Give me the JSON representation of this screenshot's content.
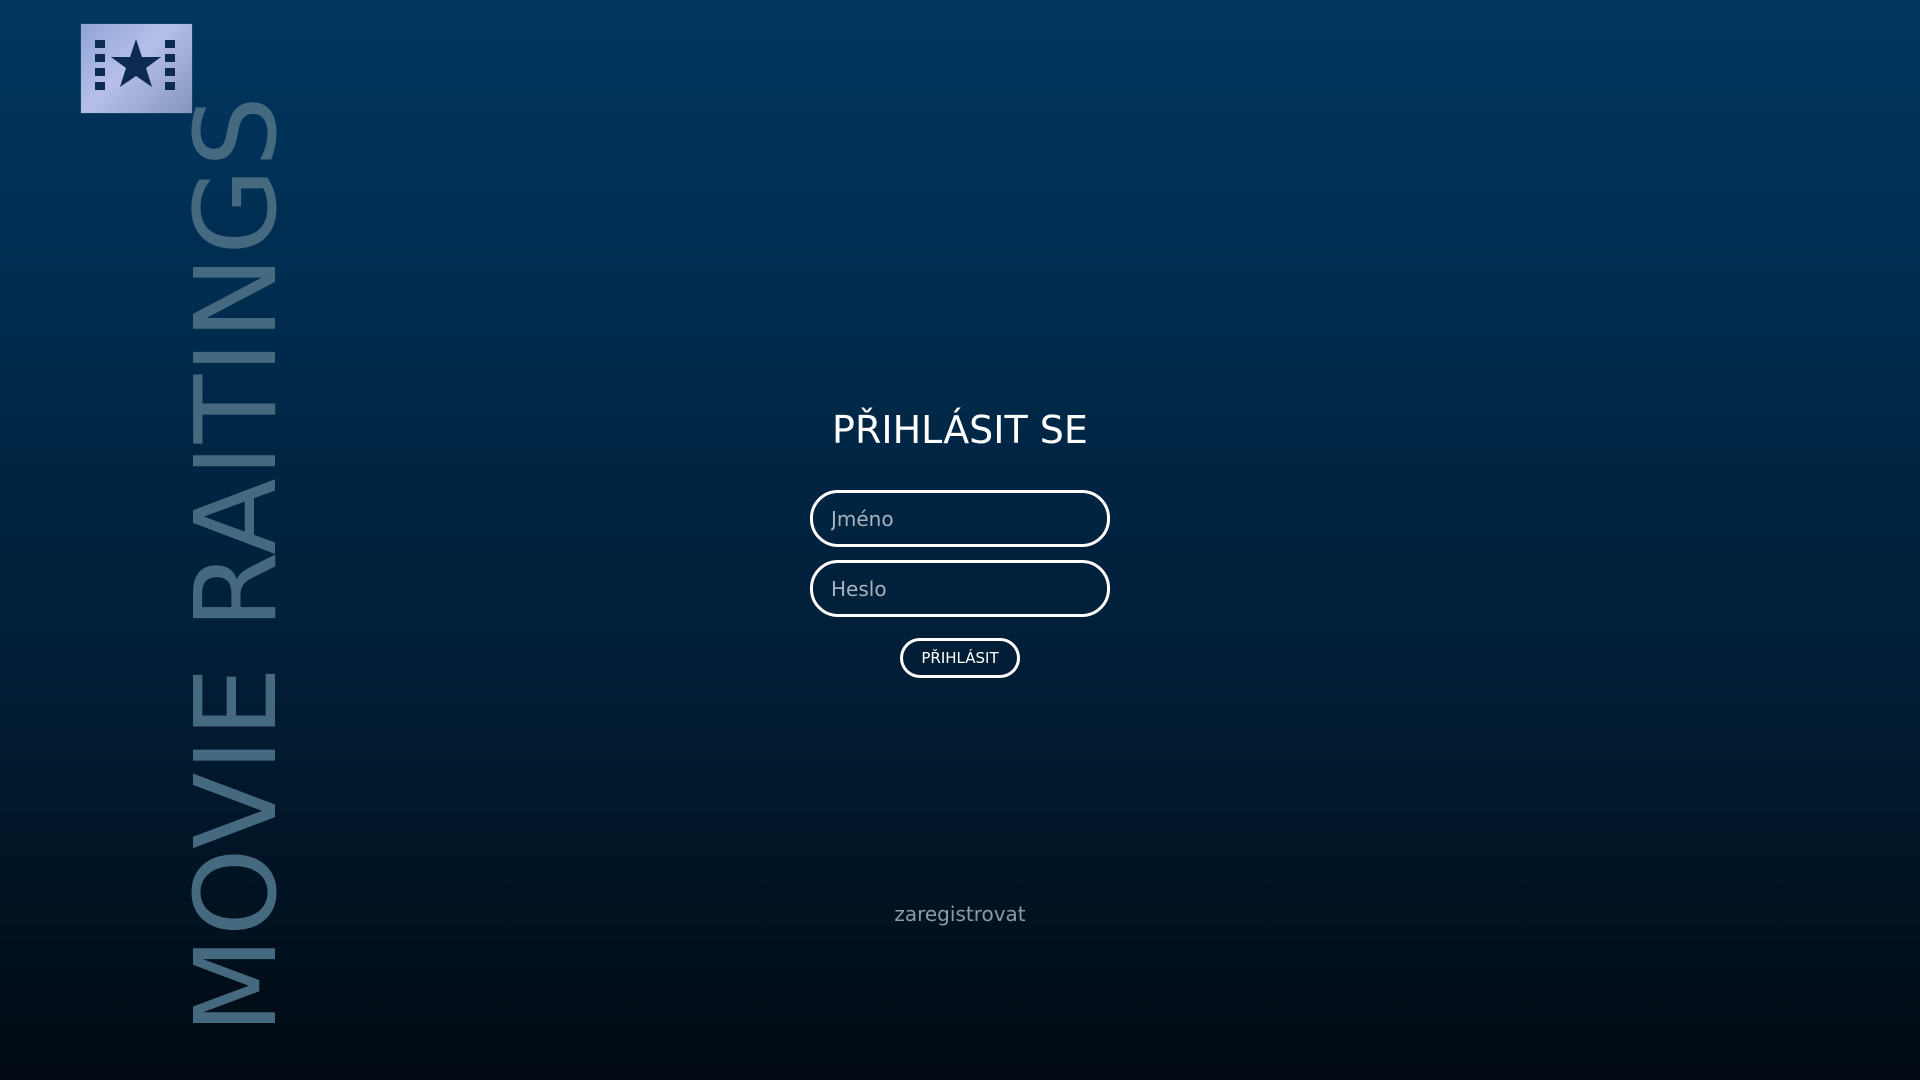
{
  "brand": {
    "title": "MOVIE RAITINGS",
    "logo_icon": "film-star-icon",
    "title_color": "#45697f"
  },
  "login": {
    "title": "PŘIHLÁSIT SE",
    "name_placeholder": "Jméno",
    "password_placeholder": "Heslo",
    "submit_label": "PŘIHLÁSIT"
  },
  "register": {
    "link_label": "zaregistrovat"
  },
  "colors": {
    "background_top": "#003660",
    "background_bottom": "#010a12",
    "text": "#ffffff",
    "muted_text": "#8f9aa4"
  }
}
